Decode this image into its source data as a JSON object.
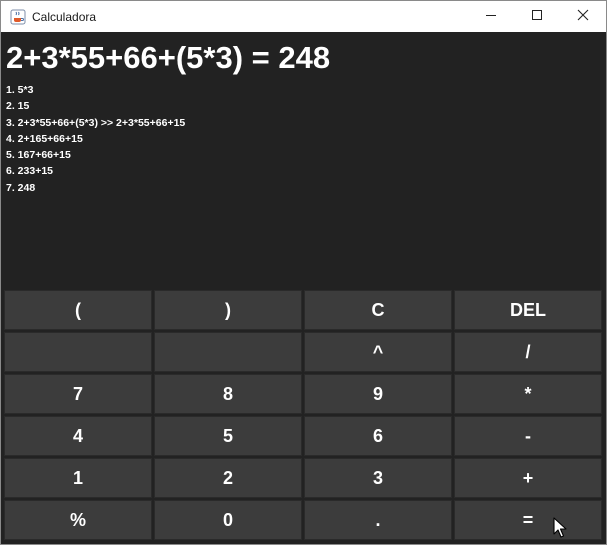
{
  "window": {
    "title": "Calculadora",
    "icon": "java-cup-icon",
    "controls": [
      "minimize-icon",
      "maximize-icon",
      "close-icon"
    ]
  },
  "display": {
    "expression": "2+3*55+66+(5*3) = 248",
    "steps": [
      "1. 5*3",
      "2. 15",
      "3. 2+3*55+66+(5*3) >> 2+3*55+66+15",
      "4. 2+165+66+15",
      "5. 167+66+15",
      "6. 233+15",
      "7. 248"
    ]
  },
  "keypad": {
    "rows": [
      [
        "(",
        ")",
        "C",
        "DEL"
      ],
      [
        "",
        "",
        "^",
        "/"
      ],
      [
        "7",
        "8",
        "9",
        "*"
      ],
      [
        "4",
        "5",
        "6",
        "-"
      ],
      [
        "1",
        "2",
        "3",
        "+"
      ],
      [
        "%",
        "0",
        ".",
        "="
      ]
    ]
  },
  "colors": {
    "background": "#222222",
    "button": "#3c3c3c",
    "text": "#ffffff"
  }
}
